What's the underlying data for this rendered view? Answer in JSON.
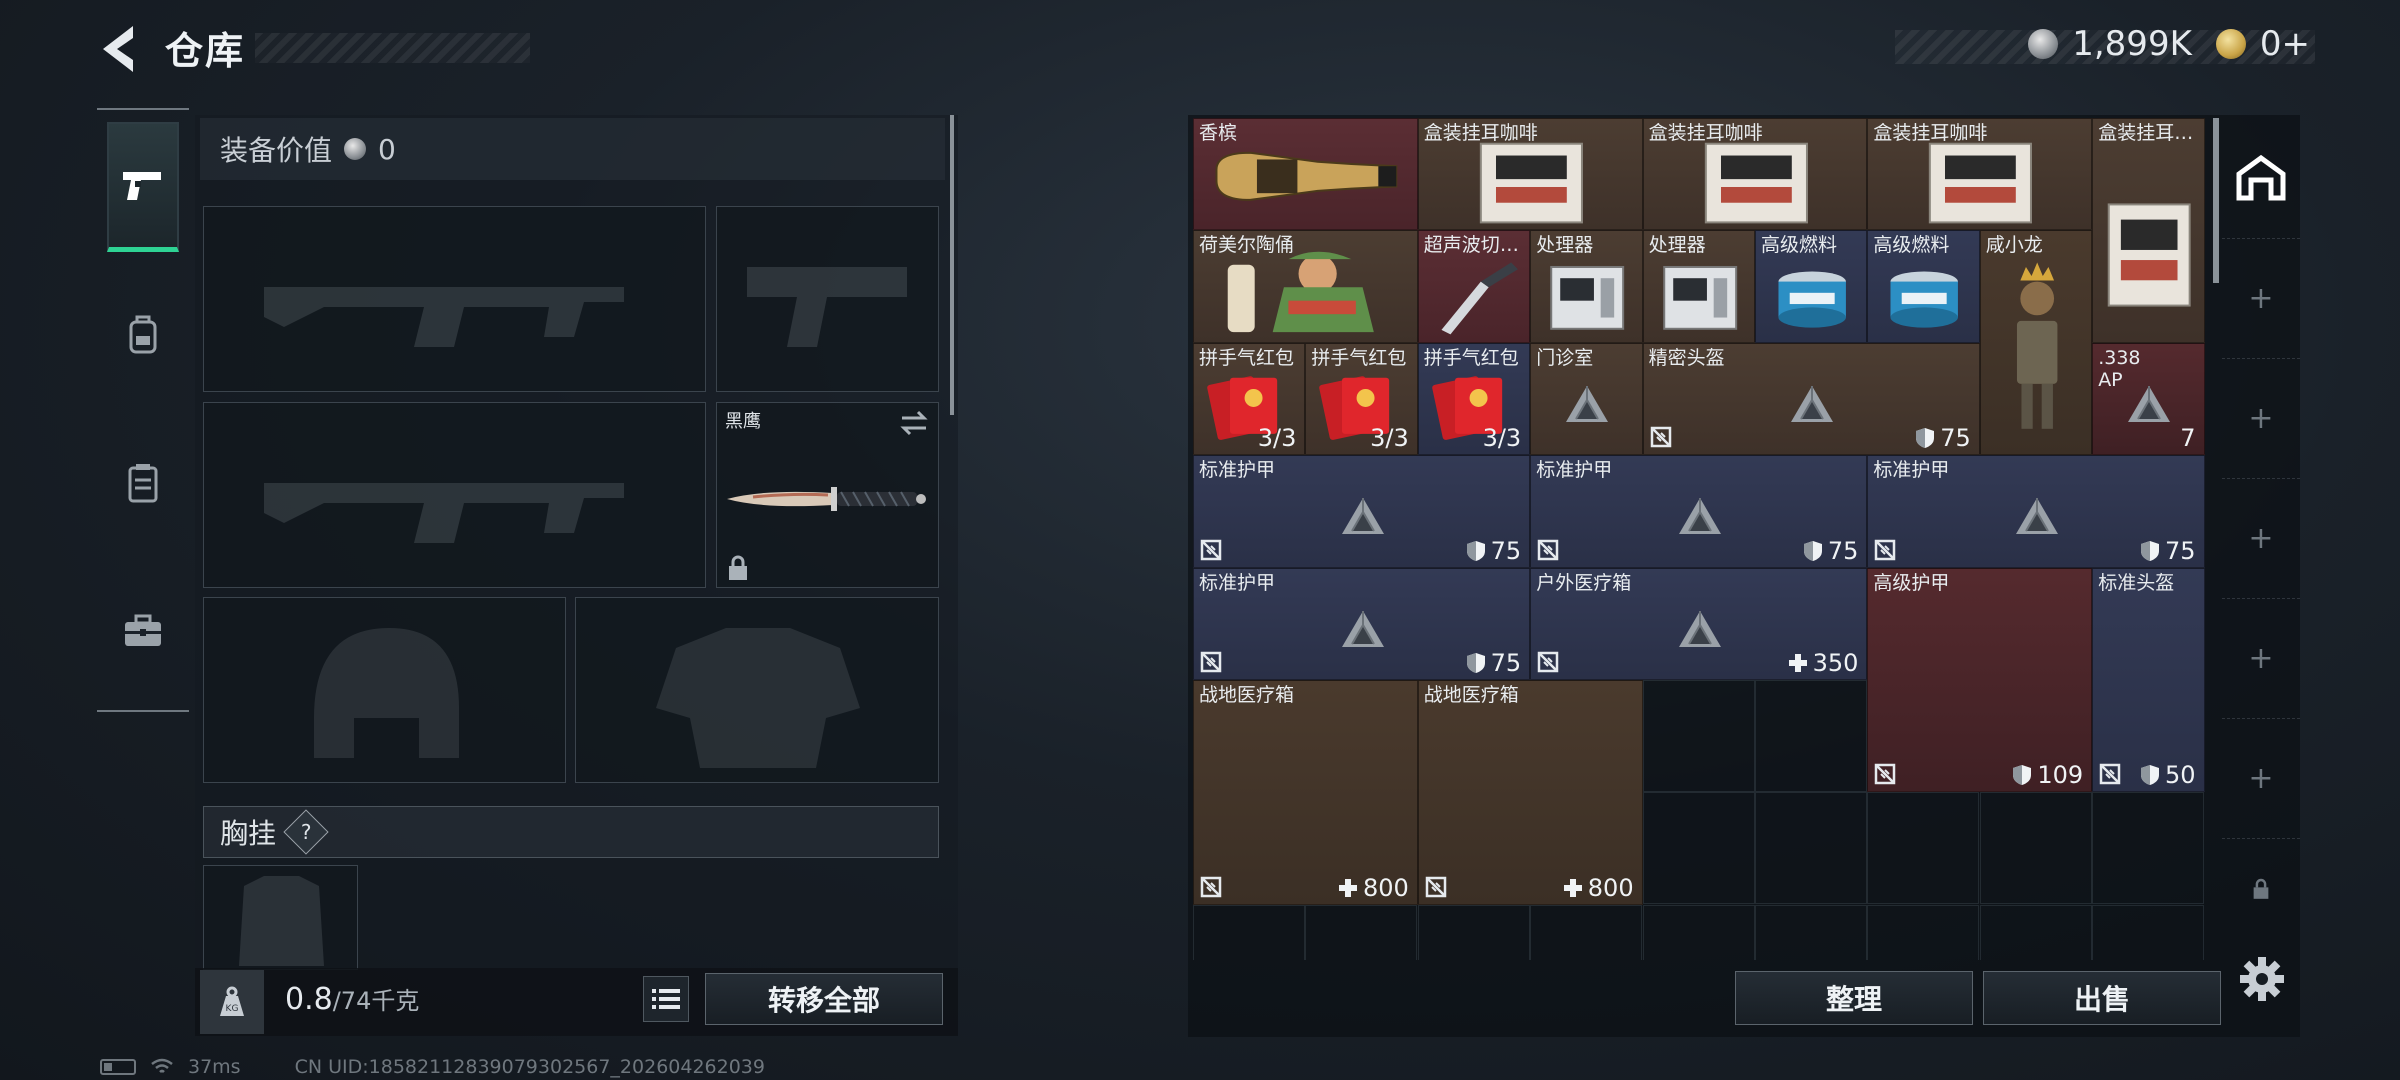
{
  "header": {
    "title": "仓库",
    "silver": "1,899K",
    "gold": "0+"
  },
  "colors": {
    "accent_green": "#2ed394",
    "rarity_red": "#5b2e34",
    "rarity_gold": "#4c3d32",
    "rarity_blue": "#333a55",
    "rarity_purple": "#3a2f52"
  },
  "left_tabs": [
    {
      "icon": "pistol-icon",
      "active": true
    },
    {
      "icon": "backpack-icon",
      "active": false
    },
    {
      "icon": "vest-icon",
      "active": false
    },
    {
      "icon": "briefcase-icon",
      "active": false
    }
  ],
  "equipment": {
    "value_label": "装备价值",
    "value": "0",
    "melee_name": "黑鹰",
    "chest_rig_label": "胸挂",
    "chest_rig_help": "?",
    "weight_current": "0.8",
    "weight_max": "/74千克",
    "transfer_all": "转移全部"
  },
  "storage": {
    "items": [
      {
        "name": "香槟",
        "c": 0,
        "r": 0,
        "w": 2,
        "h": 1,
        "color": "red",
        "art": "champagne"
      },
      {
        "name": "盒装挂耳咖啡",
        "c": 2,
        "r": 0,
        "w": 2,
        "h": 1,
        "color": "gold",
        "art": "coffee"
      },
      {
        "name": "盒装挂耳咖啡",
        "c": 4,
        "r": 0,
        "w": 2,
        "h": 1,
        "color": "gold",
        "art": "coffee"
      },
      {
        "name": "盒装挂耳咖啡",
        "c": 6,
        "r": 0,
        "w": 2,
        "h": 1,
        "color": "gold",
        "art": "coffee"
      },
      {
        "name": "盒装挂耳咖啡",
        "c": 8,
        "r": 0,
        "w": 1,
        "h": 2,
        "color": "gold",
        "art": "coffee-tall"
      },
      {
        "name": "荷美尔陶俑",
        "c": 0,
        "r": 1,
        "w": 2,
        "h": 1,
        "color": "gold",
        "art": "figurine"
      },
      {
        "name": "超声波切割刀",
        "c": 2,
        "r": 1,
        "w": 1,
        "h": 1,
        "color": "red",
        "art": "knife"
      },
      {
        "name": "处理器",
        "c": 3,
        "r": 1,
        "w": 1,
        "h": 1,
        "color": "gold",
        "art": "cpu"
      },
      {
        "name": "处理器",
        "c": 4,
        "r": 1,
        "w": 1,
        "h": 1,
        "color": "gold",
        "art": "cpu"
      },
      {
        "name": "高级燃料",
        "c": 5,
        "r": 1,
        "w": 1,
        "h": 1,
        "color": "blue",
        "art": "fuel"
      },
      {
        "name": "高级燃料",
        "c": 6,
        "r": 1,
        "w": 1,
        "h": 1,
        "color": "blue",
        "art": "fuel"
      },
      {
        "name": "咸小龙",
        "c": 7,
        "r": 1,
        "w": 1,
        "h": 2,
        "color": "brown",
        "art": "doll"
      },
      {
        "name": "拼手气红包",
        "c": 0,
        "r": 2,
        "w": 1,
        "h": 1,
        "color": "gold",
        "art": "redpack",
        "count": "3/3"
      },
      {
        "name": "拼手气红包",
        "c": 1,
        "r": 2,
        "w": 1,
        "h": 1,
        "color": "gold",
        "art": "redpack",
        "count": "3/3"
      },
      {
        "name": "拼手气红包",
        "c": 2,
        "r": 2,
        "w": 1,
        "h": 1,
        "color": "blue",
        "art": "redpack",
        "count": "3/3"
      },
      {
        "name": "门诊室",
        "c": 3,
        "r": 2,
        "w": 1,
        "h": 1,
        "color": "gold",
        "art": "mystery"
      },
      {
        "name": "精密头盔",
        "c": 4,
        "r": 2,
        "w": 3,
        "h": 1,
        "color": "gold",
        "art": "mystery",
        "nosell": true,
        "value": "75",
        "vicon": "shield"
      },
      {
        "name": ".338\nAP",
        "c": 8,
        "r": 2,
        "w": 1,
        "h": 1,
        "color": "dkred",
        "art": "mystery",
        "count": "7"
      },
      {
        "name": "标准护甲",
        "c": 0,
        "r": 3,
        "w": 3,
        "h": 1,
        "color": "blue",
        "art": "mystery",
        "nosell": true,
        "value": "75",
        "vicon": "shield"
      },
      {
        "name": "标准护甲",
        "c": 3,
        "r": 3,
        "w": 3,
        "h": 1,
        "color": "blue",
        "art": "mystery",
        "nosell": true,
        "value": "75",
        "vicon": "shield"
      },
      {
        "name": "标准护甲",
        "c": 6,
        "r": 3,
        "w": 3,
        "h": 1,
        "color": "blue",
        "art": "mystery",
        "nosell": true,
        "value": "75",
        "vicon": "shield"
      },
      {
        "name": "标准护甲",
        "c": 0,
        "r": 4,
        "w": 3,
        "h": 1,
        "color": "blue",
        "art": "mystery",
        "nosell": true,
        "value": "75",
        "vicon": "shield"
      },
      {
        "name": "户外医疗箱",
        "c": 3,
        "r": 4,
        "w": 3,
        "h": 1,
        "color": "blue",
        "art": "mystery",
        "nosell": true,
        "value": "350",
        "vicon": "plus"
      },
      {
        "name": "高级护甲",
        "c": 6,
        "r": 4,
        "w": 2,
        "h": 2,
        "color": "dkred",
        "art": "none",
        "nosell": true,
        "value": "109",
        "vicon": "shield"
      },
      {
        "name": "标准头盔",
        "c": 8,
        "r": 4,
        "w": 1,
        "h": 2,
        "color": "blue",
        "art": "none",
        "nosell": true,
        "value": "50",
        "vicon": "shield"
      },
      {
        "name": "战地医疗箱",
        "c": 0,
        "r": 5,
        "w": 2,
        "h": 2,
        "color": "brown",
        "art": "none",
        "nosell": true,
        "value": "800",
        "vicon": "plus"
      },
      {
        "name": "战地医疗箱",
        "c": 2,
        "r": 5,
        "w": 2,
        "h": 2,
        "color": "brown",
        "art": "none",
        "nosell": true,
        "value": "800",
        "vicon": "plus"
      }
    ],
    "sort_label": "整理",
    "sell_label": "出售"
  },
  "status": {
    "ping": "37ms",
    "uid": "CN UID:1858211283907930​2567_202604262039"
  }
}
